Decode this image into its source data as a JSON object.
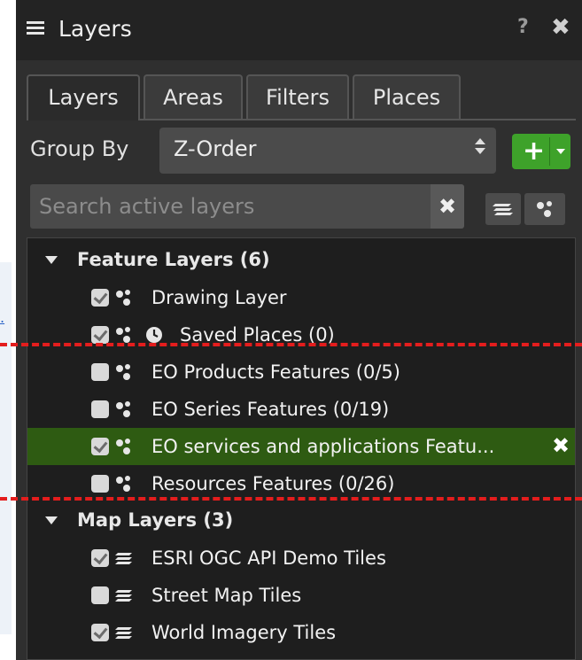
{
  "panel": {
    "title": "Layers",
    "help_label": "?",
    "close_label": "✖"
  },
  "tabs": [
    {
      "label": "Layers",
      "active": true
    },
    {
      "label": "Areas",
      "active": false
    },
    {
      "label": "Filters",
      "active": false
    },
    {
      "label": "Places",
      "active": false
    }
  ],
  "group_by": {
    "label": "Group By",
    "value": "Z-Order"
  },
  "add_button": {
    "plus": "+"
  },
  "search": {
    "placeholder": "Search active layers",
    "clear_label": "✖"
  },
  "tree": {
    "groups": [
      {
        "label": "Feature Layers (6)",
        "items": [
          {
            "label": "Drawing Layer",
            "checked": true,
            "icon": "features-icon",
            "clock": false,
            "selected": false
          },
          {
            "label": "Saved Places (0)",
            "checked": true,
            "icon": "features-icon",
            "clock": true,
            "selected": false
          },
          {
            "label": "EO Products Features (0/5)",
            "checked": false,
            "icon": "features-icon",
            "clock": false,
            "selected": false
          },
          {
            "label": "EO Series Features (0/19)",
            "checked": false,
            "icon": "features-icon",
            "clock": false,
            "selected": false
          },
          {
            "label": "EO services and applications Featu...",
            "checked": true,
            "icon": "features-icon",
            "clock": false,
            "selected": true
          },
          {
            "label": "Resources Features (0/26)",
            "checked": false,
            "icon": "features-icon",
            "clock": false,
            "selected": false
          }
        ]
      },
      {
        "label": "Map Layers (3)",
        "items": [
          {
            "label": "ESRI OGC API Demo Tiles",
            "checked": true,
            "icon": "tiles-icon"
          },
          {
            "label": "Street Map Tiles",
            "checked": false,
            "icon": "tiles-icon"
          },
          {
            "label": "World Imagery Tiles",
            "checked": true,
            "icon": "tiles-icon"
          }
        ]
      }
    ],
    "remove_label": "✖"
  },
  "colors": {
    "panel_bg": "#2f2f2f",
    "title_bg": "#232323",
    "tree_bg": "#1e1e1e",
    "selected_row": "#2e5b12",
    "add_button": "#3ea22a",
    "annotation_dash": "#e41d1d"
  }
}
